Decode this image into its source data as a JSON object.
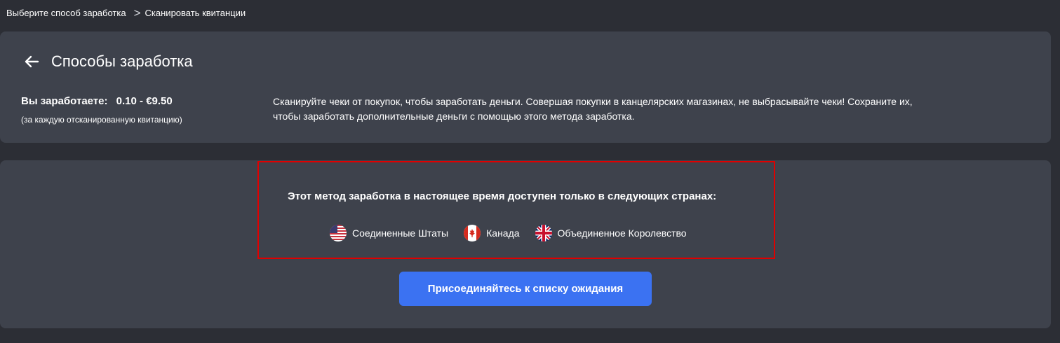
{
  "breadcrumb": {
    "items": [
      "Выберите способ заработка",
      "Сканировать квитанции"
    ],
    "separator": ">"
  },
  "header": {
    "title": "Способы заработка",
    "back_icon": "arrow-left-icon"
  },
  "earnings": {
    "label": "Вы заработаете:",
    "range": "0.10 - €9.50",
    "note": "(за каждую отсканированную квитанцию)"
  },
  "description": "Сканируйте чеки от покупок, чтобы заработать деньги. Совершая покупки в канцелярских магазинах, не выбрасывайте чеки! Сохраните их, чтобы заработать дополнительные деньги с помощью этого метода заработка.",
  "availability": {
    "text": "Этот метод заработка в настоящее время доступен только в следующих странах:",
    "countries": [
      {
        "name": "Соединенные Штаты",
        "flag": "us-flag-icon"
      },
      {
        "name": "Канада",
        "flag": "canada-flag-icon"
      },
      {
        "name": "Объединенное Королевство",
        "flag": "uk-flag-icon"
      }
    ]
  },
  "waitlist_button": "Присоединяйтесь к списку ожидания",
  "colors": {
    "background": "#2c2e35",
    "card": "#3e424c",
    "accent": "#3b72f2",
    "highlight": "#e00000"
  }
}
